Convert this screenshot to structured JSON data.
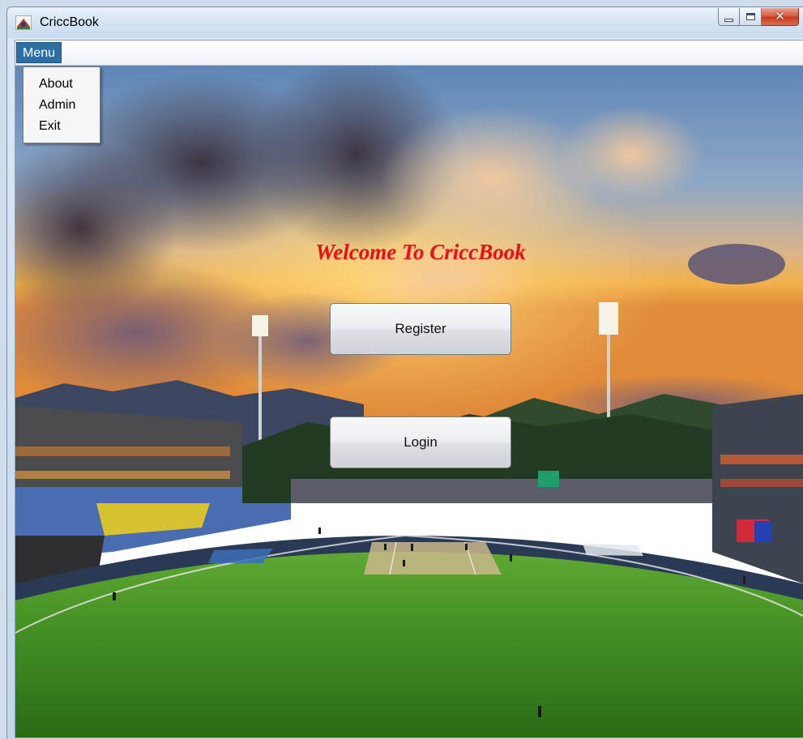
{
  "window": {
    "title": "CriccBook",
    "controls": {
      "minimize": "minimize",
      "maximize": "maximize",
      "close": "close"
    }
  },
  "menubar": {
    "menu_label": "Menu",
    "items": [
      {
        "label": "About"
      },
      {
        "label": "Admin"
      },
      {
        "label": "Exit"
      }
    ]
  },
  "main": {
    "welcome_text": "Welcome To CriccBook",
    "register_label": "Register",
    "login_label": "Login"
  },
  "colors": {
    "menu_highlight": "#2d6ea5",
    "welcome_text": "#e3141b",
    "close_button": "#c73a1f"
  },
  "icons": {
    "app": "cricket-app-icon",
    "minimize": "minimize-icon",
    "maximize": "maximize-icon",
    "close": "close-icon"
  }
}
